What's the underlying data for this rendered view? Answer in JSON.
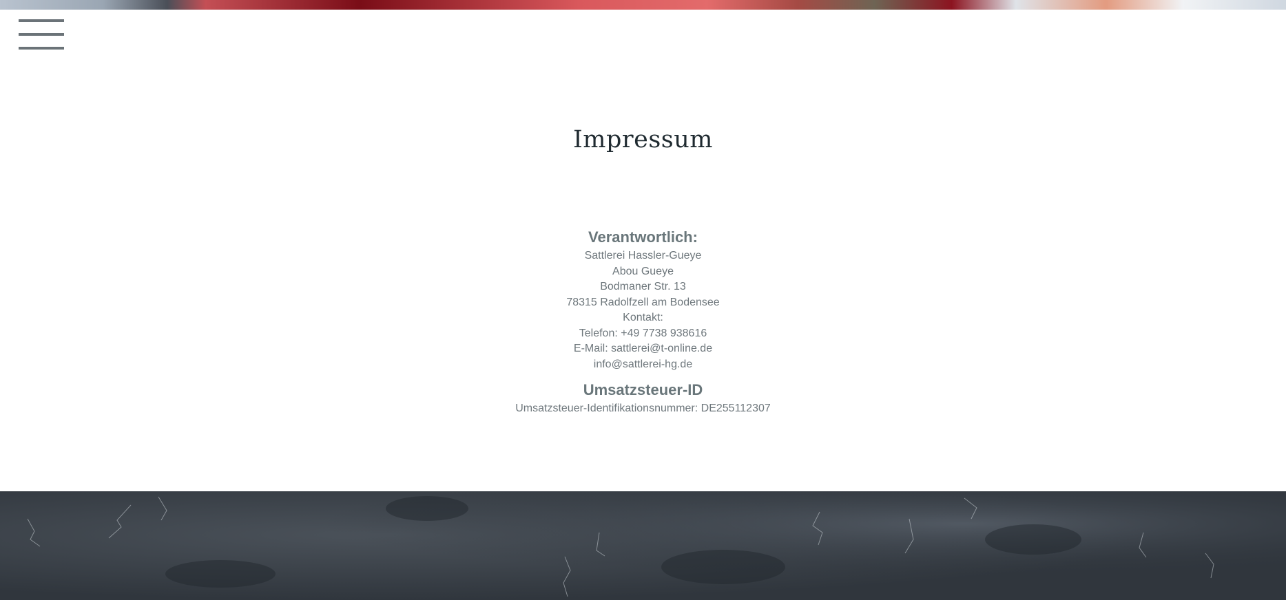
{
  "menu": {
    "icon": "hamburger-menu-icon"
  },
  "title": "Impressum",
  "responsible": {
    "heading": "Verantwortlich:",
    "lines": [
      "Sattlerei Hassler-Gueye",
      "Abou Gueye",
      "Bodmaner Str. 13",
      "78315 Radolfzell am Bodensee",
      "Kontakt:",
      "Telefon: +49 7738 938616",
      "E-Mail: sattlerei@t-online.de",
      "info@sattlerei-hg.de"
    ]
  },
  "tax": {
    "heading": "Umsatzsteuer-ID",
    "line": "Umsatzsteuer-Identifikationsnummer: DE255112307"
  },
  "colors": {
    "menu_icon": "#6b7378",
    "heading": "#69767a",
    "text": "#6e777c",
    "title": "#1f2a30",
    "footer": "#3a4048"
  }
}
